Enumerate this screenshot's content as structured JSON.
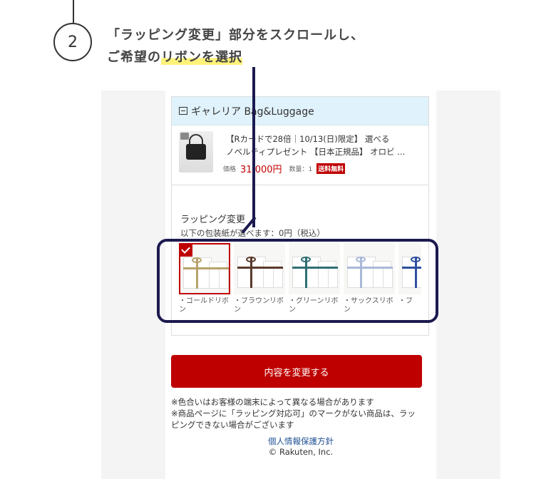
{
  "instruction": {
    "step_number": "2",
    "line1": "「ラッピング変更」部分をスクロールし、",
    "line2_prefix": "ご希望の",
    "line2_highlight": "リボンを選択"
  },
  "shop": {
    "name": "ギャレリア Bag&Luggage"
  },
  "product": {
    "title_line1": "【Rカードで28倍｜10/13(日)限定】 選べる",
    "title_line2": "ノベルティプレゼント 【日本正規品】 オロビ ...",
    "price_label": "価格",
    "price": "31,000円",
    "qty_label": "数量：1",
    "badge": "送料無料"
  },
  "wrapping": {
    "title": "ラッピング変更",
    "subtitle": "以下の包装紙が選べます：0円（税込）",
    "options": [
      {
        "label": "・ゴールドリボン",
        "ribbon_color": "#b8a36a",
        "selected": true
      },
      {
        "label": "・ブラウンリボン",
        "ribbon_color": "#5a3a2a",
        "selected": false
      },
      {
        "label": "・グリーンリボン",
        "ribbon_color": "#2f6f73",
        "selected": false
      },
      {
        "label": "・サックスリボン",
        "ribbon_color": "#a9b8d8",
        "selected": false
      },
      {
        "label": "・ブ",
        "ribbon_color": "#2f4fa0",
        "selected": false
      }
    ]
  },
  "actions": {
    "change_button": "内容を変更する"
  },
  "notes": {
    "line1": "※色合いはお客様の端末によって異なる場合があります",
    "line2": "※商品ページに「ラッピング対応可」のマークがない商品は、ラッピングできない場合がございます"
  },
  "footer": {
    "privacy_link": "個人情報保護方針",
    "copyright": "© Rakuten, Inc."
  },
  "colors": {
    "accent_red": "#bf0000",
    "annotation_navy": "#1c1a4f",
    "shop_header_bg": "#e0f2fb",
    "highlight_yellow": "#fff27a"
  }
}
